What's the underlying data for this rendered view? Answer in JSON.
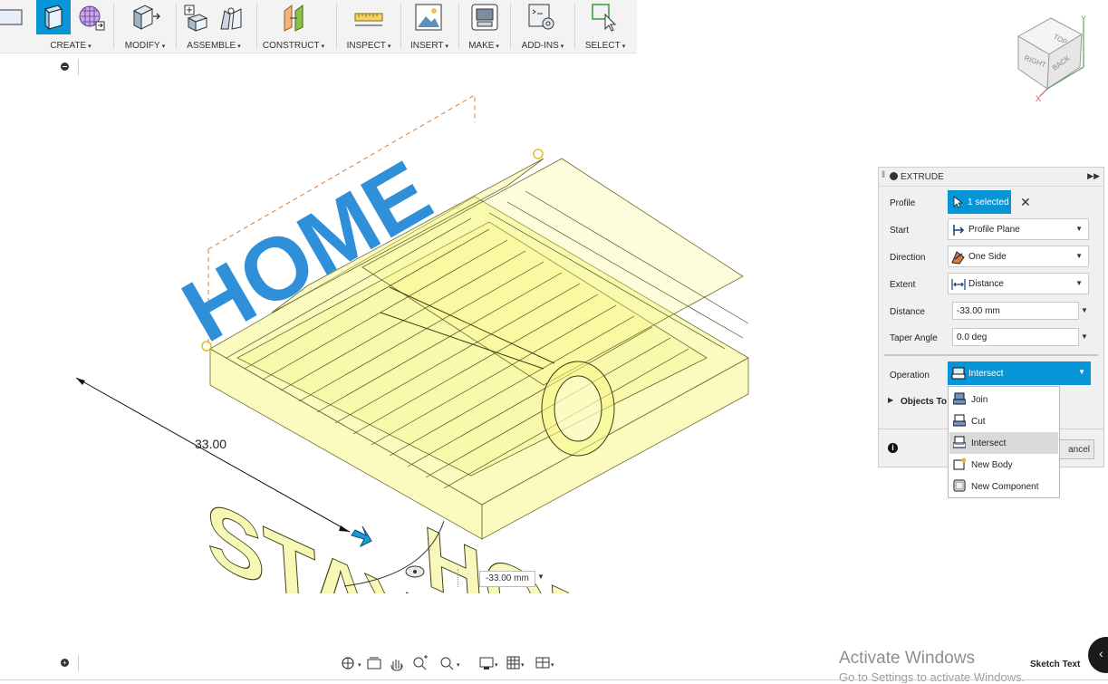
{
  "toolbar": {
    "groups": [
      {
        "label": "CREATE",
        "caret": "▾"
      },
      {
        "label": "MODIFY",
        "caret": "▾"
      },
      {
        "label": "ASSEMBLE",
        "caret": "▾"
      },
      {
        "label": "CONSTRUCT",
        "caret": "▾"
      },
      {
        "label": "INSPECT",
        "caret": "▾"
      },
      {
        "label": "INSERT",
        "caret": "▾"
      },
      {
        "label": "MAKE",
        "caret": "▾"
      },
      {
        "label": "ADD-INS",
        "caret": "▾"
      },
      {
        "label": "SELECT",
        "caret": "▾"
      }
    ]
  },
  "viewcube": {
    "top": "TOP",
    "right": "RIGHT",
    "back": "BACK",
    "axis_x": "X",
    "axis_y": "Y"
  },
  "canvas": {
    "dimension_label": "33.00",
    "distance_input": "-33.00 mm",
    "model_text_top": "HOME",
    "model_text_mid": "STAY",
    "model_text_bottom": "HOME"
  },
  "extrude": {
    "title": "EXTRUDE",
    "profile_label": "Profile",
    "profile_value": "1 selected",
    "start_label": "Start",
    "start_value": "Profile Plane",
    "direction_label": "Direction",
    "direction_value": "One Side",
    "extent_label": "Extent",
    "extent_value": "Distance",
    "distance_label": "Distance",
    "distance_value": "-33.00 mm",
    "taper_label": "Taper Angle",
    "taper_value": "0.0 deg",
    "operation_label": "Operation",
    "operation_value": "Intersect",
    "objects_label": "Objects To",
    "cancel_partial": "ancel",
    "menu": [
      "Join",
      "Cut",
      "Intersect",
      "New Body",
      "New Component"
    ],
    "menu_selected": "Intersect"
  },
  "statusbar": {
    "activate_title": "Activate Windows",
    "activate_sub": "Go to Settings to activate Windows.",
    "sketch_text": "Sketch Text"
  },
  "colors": {
    "accent": "#0696d7",
    "model_yellow": "#f7f78a",
    "model_blue": "#2f8fd8"
  }
}
